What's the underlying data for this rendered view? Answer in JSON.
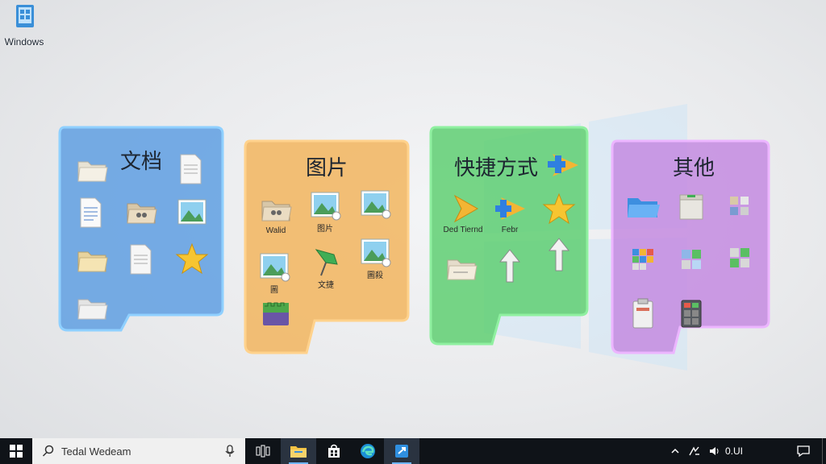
{
  "desktop": {
    "icon_label": "Windows"
  },
  "panels": {
    "docs": {
      "title": "文档",
      "color": "#5b9be0"
    },
    "pics": {
      "title": "图片",
      "color": "#f2b96a",
      "captions": [
        "Walid",
        "图片",
        "",
        "圖",
        "文捷",
        "圖殺"
      ]
    },
    "shortcuts": {
      "title": "快捷方式",
      "color": "#6ed27c",
      "captions": [
        "Ded Tiernd",
        "Febr"
      ]
    },
    "other": {
      "title": "其他",
      "color": "#c88be0"
    }
  },
  "taskbar": {
    "search_text": "Tedal Wedeam",
    "tray_time": "0.UI"
  }
}
